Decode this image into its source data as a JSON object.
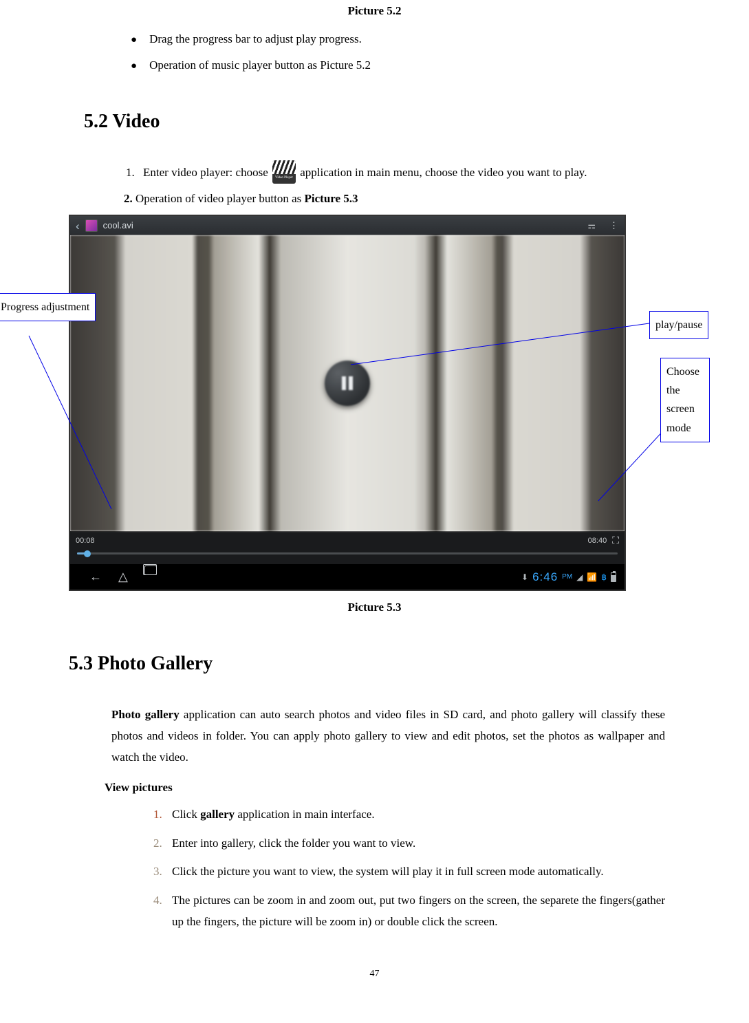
{
  "captions": {
    "p52": "Picture 5.2",
    "p53": "Picture 5.3"
  },
  "bullets": {
    "b1": "Drag the progress bar to adjust play progress.",
    "b2": "Operation of music player button as Picture 5.2"
  },
  "sections": {
    "video_title": "5.2 Video",
    "gallery_title": "5.3 Photo Gallery"
  },
  "video_steps": {
    "s1a": "Enter video player: choose ",
    "s1b": "application in main menu, choose the video you want to play.",
    "s2a": "Operation of video player button as ",
    "s2b": "Picture 5.3",
    "app_icon_label": "Video Player"
  },
  "figure": {
    "file_name": "cool.avi",
    "time_current": "00:08",
    "time_total": "08:40",
    "clock": "6:46",
    "clock_ampm": "PM"
  },
  "callouts": {
    "progress": "Progress adjustment",
    "playpause": "play/pause",
    "screenmode": "Choose the screen mode"
  },
  "gallery": {
    "para_a": "Photo gallery",
    "para_b": " application can auto search photos and video files in SD card, and photo gallery will classify these photos and videos in folder. You can apply photo gallery to view and edit photos, set the photos as wallpaper and watch the video.",
    "subhead": "View pictures",
    "g1a": "Click ",
    "g1b": "gallery",
    "g1c": " application in main interface.",
    "g2": "Enter into gallery, click the folder you want to view.",
    "g3": "Click the picture you want to view, the system will play it in full screen mode automatically.",
    "g4": "The pictures can be zoom in and zoom out, put two fingers on the screen, the separete the fingers(gather up the fingers, the picture will be zoom in) or double click the screen."
  },
  "page_number": "47"
}
